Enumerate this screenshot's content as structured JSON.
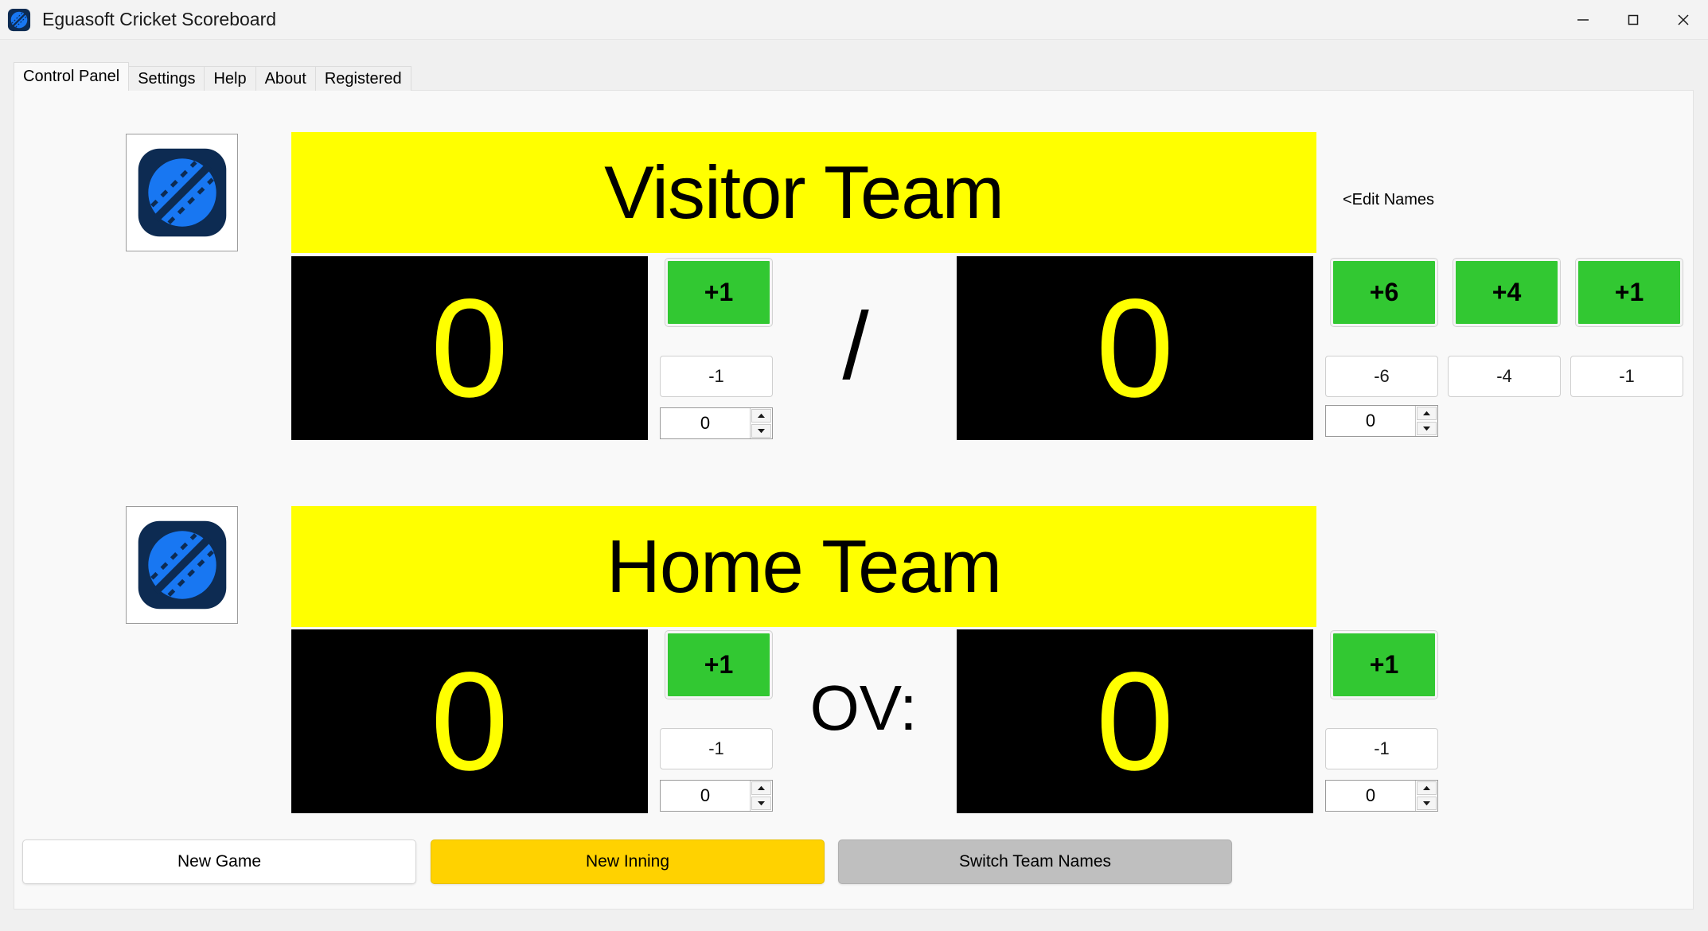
{
  "window": {
    "title": "Eguasoft Cricket Scoreboard",
    "icon": "cricket-ball-icon",
    "controls": {
      "minimize": "minimize-icon",
      "maximize": "maximize-icon",
      "close": "close-icon"
    }
  },
  "tabs": [
    {
      "label": "Control Panel",
      "active": true
    },
    {
      "label": "Settings",
      "active": false
    },
    {
      "label": "Help",
      "active": false
    },
    {
      "label": "About",
      "active": false
    },
    {
      "label": "Registered",
      "active": false
    }
  ],
  "edit_names_link": "<Edit Names",
  "colors": {
    "banner_bg": "#FFFF00",
    "banner_text": "#000000",
    "score_bg": "#000000",
    "score_text": "#FFFF00",
    "plus_button_bg": "#32C832",
    "new_inning_bg": "#FFD200",
    "switch_names_bg": "#BFBFBF",
    "window_bg": "#F0F0F0",
    "panel_bg": "#F9F9F9"
  },
  "rows": [
    {
      "id": "visitor",
      "logo": "cricket-ball-icon",
      "team_name": "Visitor Team",
      "left_score": "0",
      "separator": "/",
      "right_score": "0",
      "left_plus": "+1",
      "left_minus": "-1",
      "left_spinner_value": "0",
      "right_buttons": [
        {
          "plus": "+6",
          "minus": "-6",
          "spinner_value": "0"
        },
        {
          "plus": "+4",
          "minus": "-4"
        },
        {
          "plus": "+1",
          "minus": "-1"
        }
      ]
    },
    {
      "id": "home",
      "logo": "cricket-ball-icon",
      "team_name": "Home Team",
      "left_score": "0",
      "separator": "OV:",
      "right_score": "0",
      "left_plus": "+1",
      "left_minus": "-1",
      "left_spinner_value": "0",
      "right_buttons": [
        {
          "plus": "+1",
          "minus": "-1",
          "spinner_value": "0"
        }
      ]
    }
  ],
  "footer_buttons": [
    {
      "label": "New Game",
      "style": "white"
    },
    {
      "label": "New Inning",
      "style": "gold"
    },
    {
      "label": "Switch Team Names",
      "style": "gray"
    }
  ]
}
